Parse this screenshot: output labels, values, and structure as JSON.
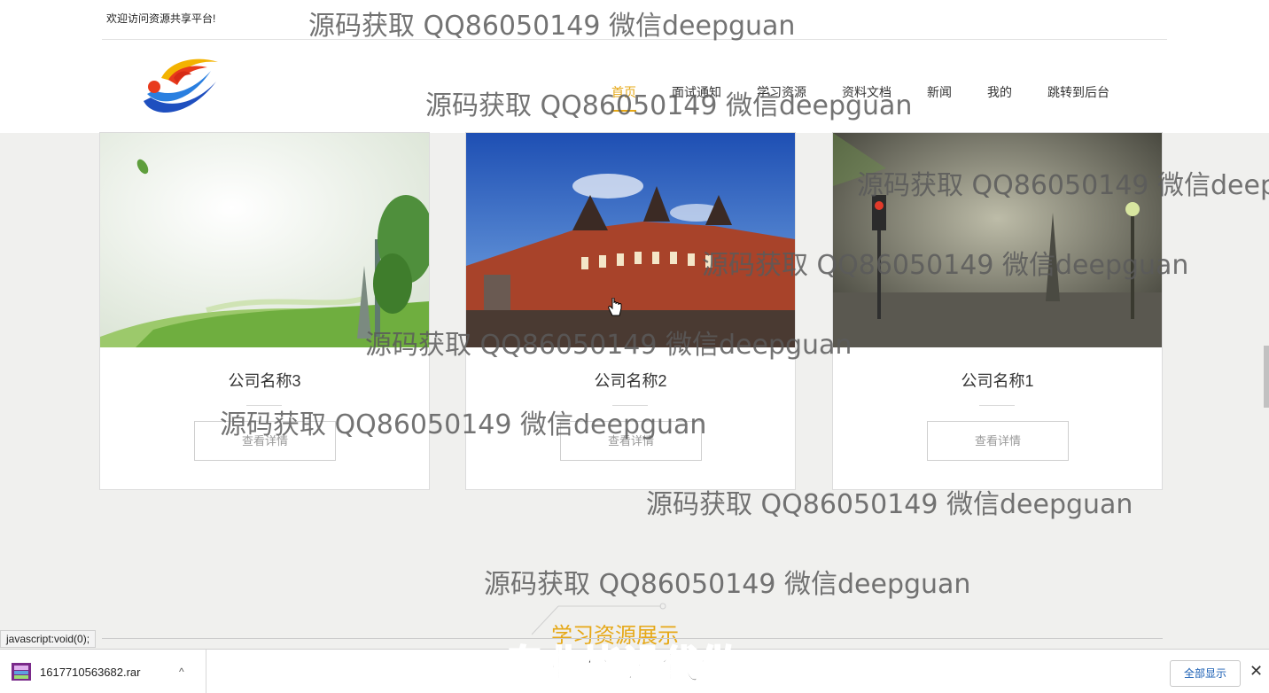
{
  "header": {
    "welcome": "欢迎访问资源共享平台!",
    "nav": [
      "首页",
      "面试通知",
      "学习资源",
      "资料文档",
      "新闻",
      "我的",
      "跳转到后台"
    ],
    "active_nav": "首页"
  },
  "cards": [
    {
      "title": "公司名称3",
      "button": "查看详情"
    },
    {
      "title": "公司名称2",
      "button": "查看详情"
    },
    {
      "title": "公司名称1",
      "button": "查看详情"
    }
  ],
  "section": {
    "title": "学习资源展示"
  },
  "status_bar": {
    "url": "javascript:void(0);"
  },
  "downloads": {
    "file_name": "1617710563682.rar",
    "show_all": "全部显示",
    "close": "✕",
    "chevron": "^"
  },
  "watermark": {
    "text": "源码获取 QQ86050149 微信deepguan",
    "banner": "专业毕设代做"
  },
  "colors": {
    "accent": "#e6a817",
    "link": "#1a5fb4"
  }
}
